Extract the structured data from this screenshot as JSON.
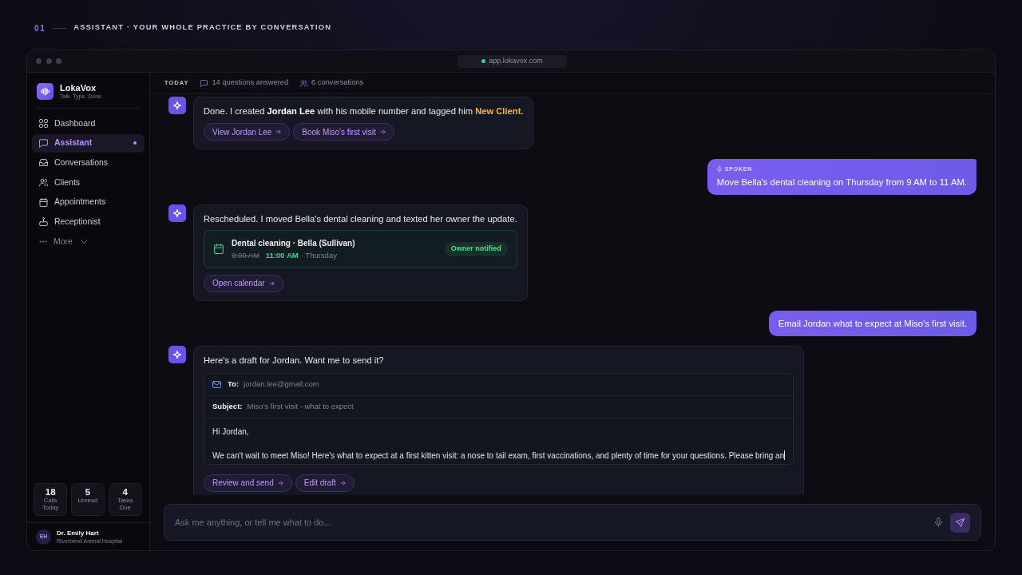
{
  "header": {
    "number": "01",
    "title": "ASSISTANT · YOUR WHOLE PRACTICE BY CONVERSATION"
  },
  "window": {
    "url": "app.lokavox.com"
  },
  "sidebar": {
    "brand": {
      "name": "LokaVox",
      "tagline": "Talk. Type. Done."
    },
    "items": [
      {
        "label": "Dashboard",
        "selected": false
      },
      {
        "label": "Assistant",
        "selected": true
      },
      {
        "label": "Conversations",
        "selected": false
      },
      {
        "label": "Clients",
        "selected": false
      },
      {
        "label": "Appointments",
        "selected": false
      },
      {
        "label": "Receptionist",
        "selected": false
      }
    ],
    "more": {
      "label": "More",
      "expanded": false
    },
    "stats": [
      {
        "value": "18",
        "label": "Calls Today"
      },
      {
        "value": "5",
        "label": "Unread"
      },
      {
        "value": "4",
        "label": "Tasks Due"
      }
    ],
    "user": {
      "initials": "EH",
      "name": "Dr. Emily Hart",
      "organization": "Riverbend Animal Hospital"
    }
  },
  "topbar": {
    "day": "TODAY",
    "stats": [
      "14 questions answered",
      "6 conversations"
    ]
  },
  "messages": [
    {
      "kind": "assistant",
      "parts": [
        {
          "kind": "plain",
          "text": "Done. I created "
        },
        {
          "kind": "name",
          "text": "Jordan Lee"
        },
        {
          "kind": "plain",
          "text": " with his mobile number and tagged him "
        },
        {
          "kind": "tag",
          "text": "New Client"
        },
        {
          "kind": "plain",
          "text": "."
        }
      ],
      "actions": [
        "View Jordan Lee",
        "Book Miso's first visit"
      ]
    },
    {
      "kind": "user",
      "badge": "SPOKEN",
      "text": "Move Bella's dental cleaning on Thursday from 9 AM to 11 AM."
    },
    {
      "kind": "assistant",
      "parts": [
        {
          "kind": "plain",
          "text": "Rescheduled. I moved Bella's dental cleaning and texted her owner the update."
        }
      ],
      "appointment": {
        "title": "Dental cleaning · Bella (Sullivan)",
        "old_time": "9:00 AM",
        "new_time": "11:00 AM",
        "day": "· Thursday",
        "status": "Owner notified"
      },
      "actions": [
        "Open calendar"
      ]
    },
    {
      "kind": "user",
      "text": "Email Jordan what to expect at Miso's first visit."
    },
    {
      "kind": "assistant",
      "parts": [
        {
          "kind": "plain",
          "text": "Here's a draft for Jordan. Want me to send it?"
        }
      ],
      "email": {
        "to_label": "To:",
        "to": "jordan.lee@gmail.com",
        "subject_label": "Subject:",
        "subject": "Miso's first visit - what to expect",
        "body": [
          "Hi Jordan,",
          "We can't wait to meet Miso! Here's what to expect at a first kitten visit: a nose to tail exam, first vaccinations, and plenty of time for your questions. Please bring an"
        ]
      },
      "actions": [
        "Review and send",
        "Edit draft"
      ]
    }
  ],
  "composer": {
    "placeholder": "Ask me anything, or tell me what to do..."
  }
}
